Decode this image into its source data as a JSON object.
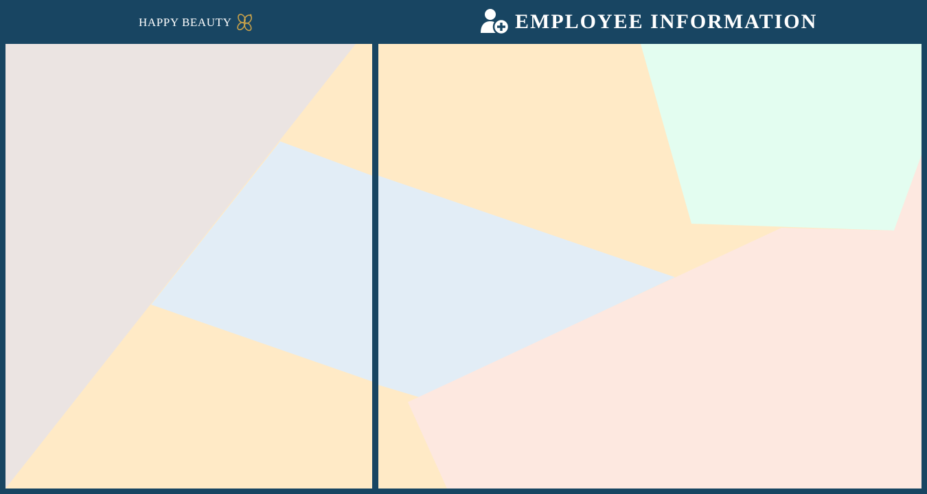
{
  "header": {
    "logo": {
      "text": "HAPPY BEAUTY",
      "mark_icon": "butterfly-flower-icon",
      "mark_color": "#c9a24a"
    },
    "title": {
      "text": "EMPLOYEE INFORMATION",
      "icon": "add-user-icon"
    },
    "background_color": "#184562"
  },
  "colors": {
    "frame": "#184562",
    "pale_yellow": "#ffeac6",
    "pale_blue": "#e2edf6",
    "pale_taupe": "#ebe4e2",
    "pale_mint": "#e3fdf0",
    "pale_peach": "#fde8e0"
  }
}
